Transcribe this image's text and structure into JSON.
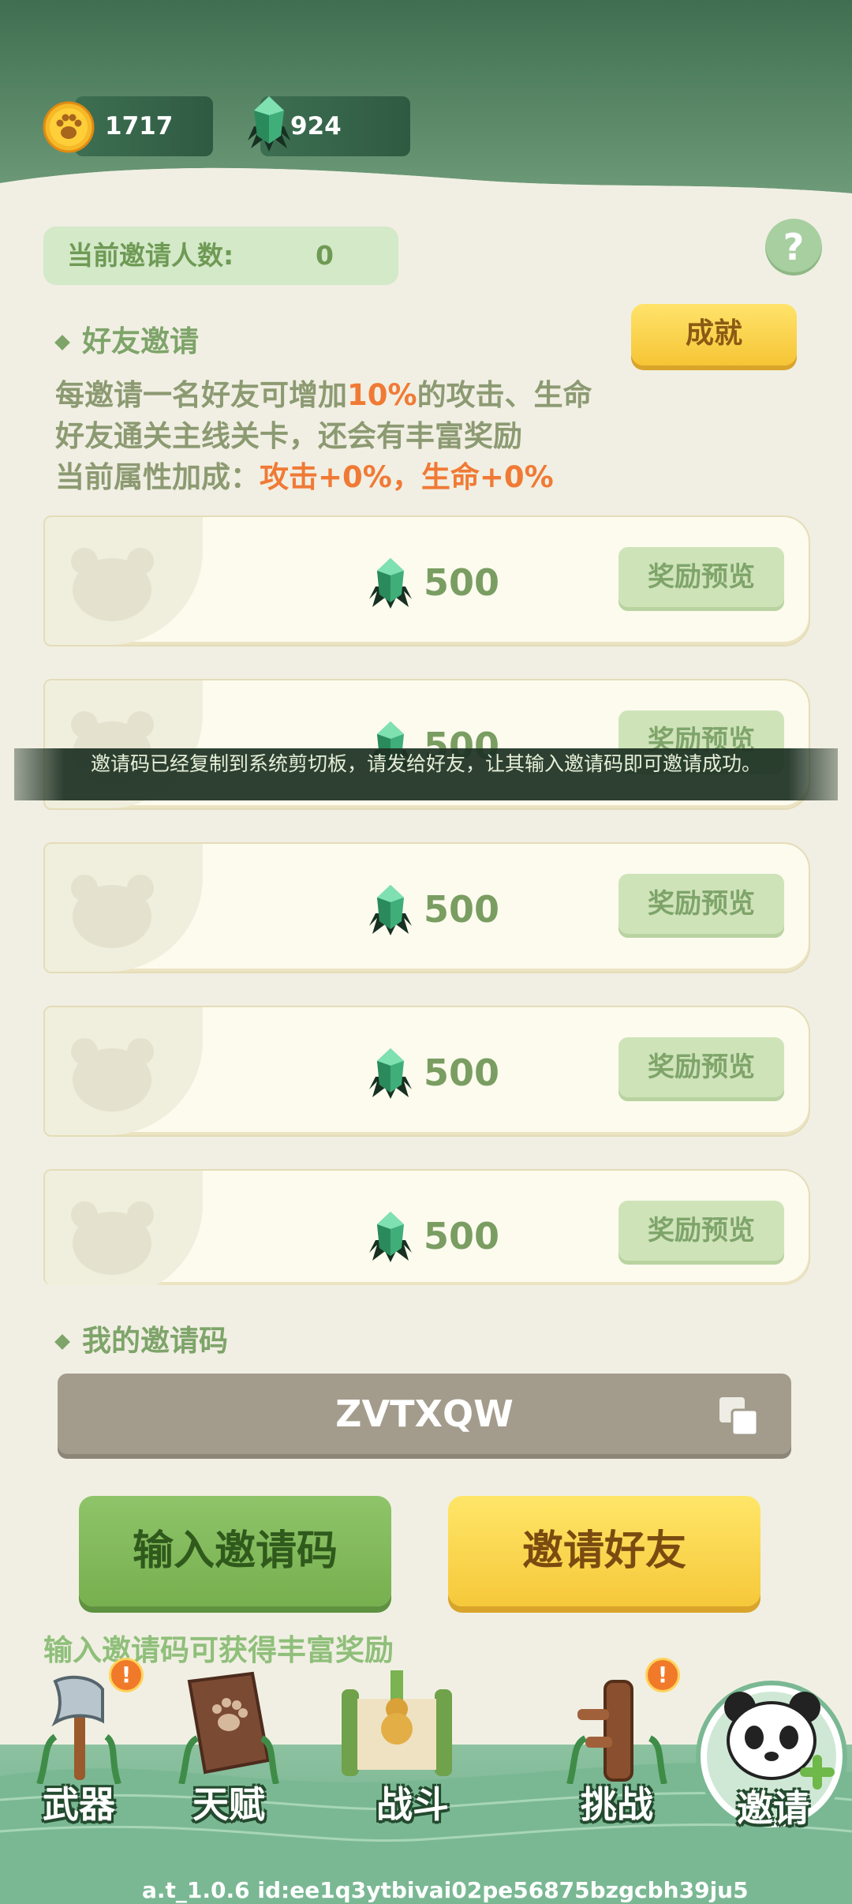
{
  "header": {
    "paw_coins": "1717",
    "gems": "924"
  },
  "invite": {
    "count_label": "当前邀请人数:",
    "count_value": "0",
    "help": "?"
  },
  "friend_section": {
    "title": "好友邀请",
    "achievement_button": "成就",
    "line1_pre": "每邀请一名好友可增加",
    "line1_pct": "10%",
    "line1_post": "的攻击、生命",
    "line2": "好友通关主线关卡，还会有丰富奖励",
    "line3_pre": "当前属性加成：",
    "line3_bonus": "攻击+0%，生命+0%"
  },
  "rewards": [
    {
      "amount": "500",
      "button": "奖励预览"
    },
    {
      "amount": "500",
      "button": "奖励预览"
    },
    {
      "amount": "500",
      "button": "奖励预览"
    },
    {
      "amount": "500",
      "button": "奖励预览"
    },
    {
      "amount": "500",
      "button": "奖励预览"
    }
  ],
  "toast": "邀请码已经复制到系统剪切板，请发给好友，让其输入邀请码即可邀请成功。",
  "my_code": {
    "title": "我的邀请码",
    "code": "ZVTXQW"
  },
  "buttons": {
    "enter_code": "输入邀请码",
    "invite_friend": "邀请好友"
  },
  "hint": "输入邀请码可获得丰富奖励",
  "nav": [
    {
      "label": "武器",
      "badge": "!"
    },
    {
      "label": "天赋",
      "badge": ""
    },
    {
      "label": "战斗",
      "badge": ""
    },
    {
      "label": "挑战",
      "badge": "!"
    },
    {
      "label": "邀请",
      "badge": ""
    }
  ],
  "footer": "a.t_1.0.6 id:ee1q3ytbivai02pe56875bzgcbh39ju5",
  "colors": {
    "accent_green": "#7ea46a",
    "orange": "#f07a35",
    "header_dark": "#2f5a42"
  }
}
